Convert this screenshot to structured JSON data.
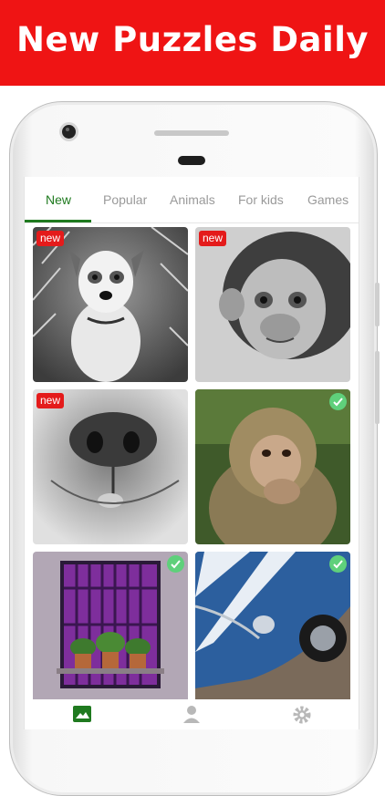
{
  "banner": {
    "title": "New Puzzles Daily"
  },
  "tabs": [
    {
      "label": "New",
      "active": true
    },
    {
      "label": "Popular"
    },
    {
      "label": "Animals"
    },
    {
      "label": "For kids"
    },
    {
      "label": "Games"
    }
  ],
  "tiles": [
    {
      "subject": "dog-photo",
      "badge": "new"
    },
    {
      "subject": "chimpanzee-photo",
      "badge": "new"
    },
    {
      "subject": "dog-nose-photo",
      "badge": "new"
    },
    {
      "subject": "monkey-photo",
      "completed": true
    },
    {
      "subject": "window-flowers-photo",
      "completed": true
    },
    {
      "subject": "blue-car-photo",
      "completed": true
    }
  ],
  "bottom_nav": [
    {
      "icon": "gallery-icon",
      "active": true
    },
    {
      "icon": "profile-icon"
    },
    {
      "icon": "settings-icon"
    }
  ],
  "colors": {
    "banner": "#ef1414",
    "accent": "#1f7a1f",
    "badge": "#e41b1b",
    "check": "#5fd07b"
  }
}
